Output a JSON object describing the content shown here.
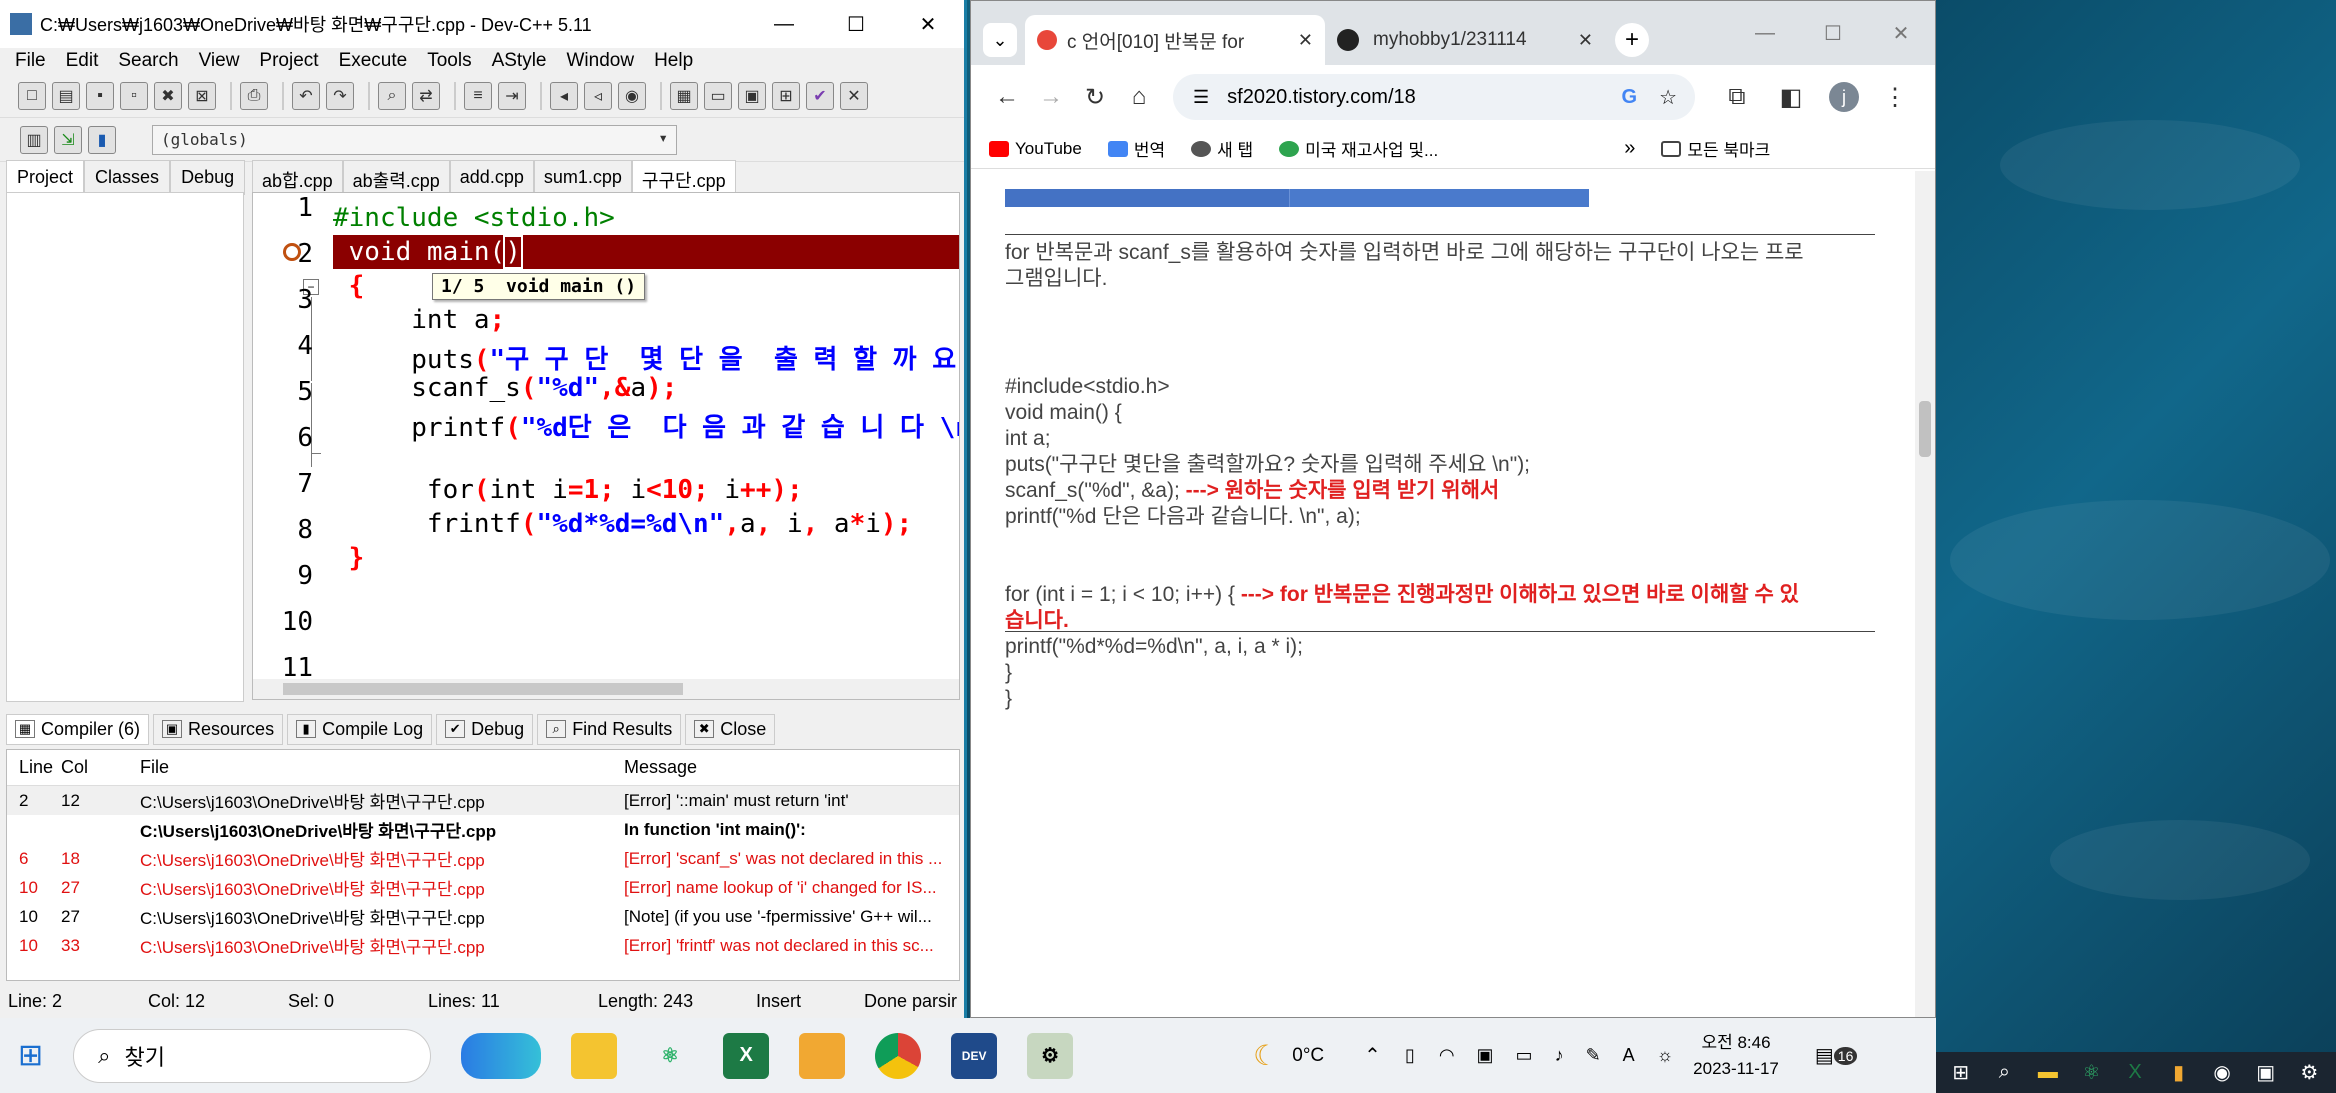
{
  "devcpp": {
    "title": "C:₩Users₩j1603₩OneDrive₩바탕 화면₩구구단.cpp - Dev-C++ 5.11",
    "menu": [
      "File",
      "Edit",
      "Search",
      "View",
      "Project",
      "Execute",
      "Tools",
      "AStyle",
      "Window",
      "Help"
    ],
    "globals": "(globals)",
    "panel_tabs": [
      "Project",
      "Classes",
      "Debug"
    ],
    "file_tabs": [
      "ab합.cpp",
      "ab출력.cpp",
      "add.cpp",
      "sum1.cpp",
      "구구단.cpp"
    ],
    "line_numbers": [
      "1",
      "2",
      "3",
      "4",
      "5",
      "6",
      "7",
      "8",
      "9",
      "10",
      "11"
    ],
    "tooltip": "1/ 5  void main ()",
    "bottom_tabs": [
      "Compiler (6)",
      "Resources",
      "Compile Log",
      "Debug",
      "Find Results",
      "Close"
    ],
    "msg_headers": [
      "Line",
      "Col",
      "File",
      "Message"
    ],
    "messages": [
      {
        "line": "2",
        "col": "12",
        "file": "C:\\Users\\j1603\\OneDrive\\바탕 화면\\구구단.cpp",
        "msg": "[Error] '::main' must return 'int'"
      },
      {
        "line": "",
        "col": "",
        "file": "C:\\Users\\j1603\\OneDrive\\바탕 화면\\구구단.cpp",
        "msg": "In function 'int main()':"
      },
      {
        "line": "6",
        "col": "18",
        "file": "C:\\Users\\j1603\\OneDrive\\바탕 화면\\구구단.cpp",
        "msg": "[Error] 'scanf_s' was not declared in this ..."
      },
      {
        "line": "10",
        "col": "27",
        "file": "C:\\Users\\j1603\\OneDrive\\바탕 화면\\구구단.cpp",
        "msg": "[Error] name lookup of 'i' changed for IS..."
      },
      {
        "line": "10",
        "col": "27",
        "file": "C:\\Users\\j1603\\OneDrive\\바탕 화면\\구구단.cpp",
        "msg": "[Note] (if you use '-fpermissive' G++ wil..."
      },
      {
        "line": "10",
        "col": "33",
        "file": "C:\\Users\\j1603\\OneDrive\\바탕 화면\\구구단.cpp",
        "msg": "[Error] 'frintf' was not declared in this sc..."
      }
    ],
    "status": {
      "line": "Line:     2",
      "col": "Col:    12",
      "sel": "Sel:     0",
      "lines": "Lines:     11",
      "length": "Length:   243",
      "mode": "Insert",
      "done": "Done parsir"
    }
  },
  "chrome": {
    "tabs": [
      {
        "label": "c 언어[010] 반복문 for"
      },
      {
        "label": "myhobby1/231114"
      }
    ],
    "url": "sf2020.tistory.com/18",
    "bookmarks": [
      "YouTube",
      "번역",
      "새 탭",
      "미국 재고사업 및...",
      "모든 북마크"
    ],
    "page": {
      "intro1": "for  반복문과 scanf_s를 활용하여 숫자를 입력하면 바로 그에 해당하는 구구단이 나오는 프로",
      "intro2": "그램입니다.",
      "c1": "#include<stdio.h>",
      "c2": "void main() {",
      "c3": "int a;",
      "c4": "puts(\"구구단 몇단을 출력할까요? 숫자를 입력해 주세요 \\n\");",
      "c5a": "scanf_s(\"%d\", &a);",
      "c5b": "---> 원하는 숫자를 입력 받기 위해서",
      "c6": "printf(\"%d 단은 다음과 같습니다. \\n\", a);",
      "c7a": "for (int i = 1; i < 10; i++) {",
      "c7b": "---> for 반복문은 진행과정만 이해하고 있으면 바로 이해할 수 있",
      "c7c": "습니다.",
      "c8": "printf(\"%d*%d=%d\\n\", a, i, a * i);",
      "c9": "}",
      "c10": "}"
    }
  },
  "taskbar": {
    "search": "찾기",
    "weather": "0°C",
    "time": "오전 8:46",
    "date": "2023-11-17",
    "notif": "16"
  }
}
